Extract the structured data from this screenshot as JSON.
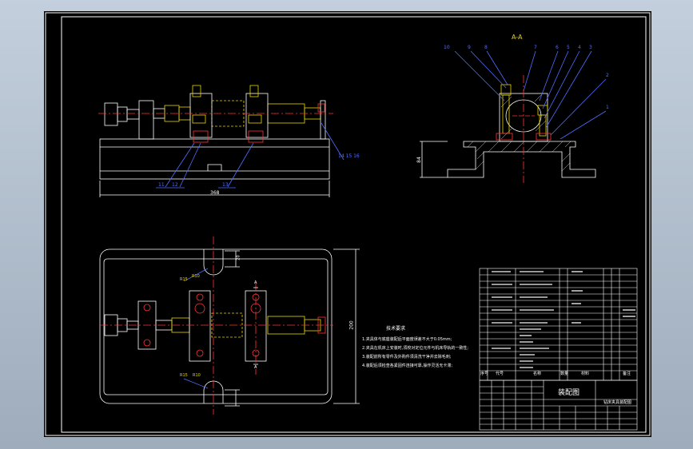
{
  "section_view": {
    "title": "A-A",
    "balloons": [
      "10",
      "9",
      "8",
      "7",
      "6",
      "5",
      "4",
      "3",
      "2",
      "1"
    ],
    "height_dim": "84"
  },
  "front_view": {
    "balloons": [
      "11",
      "12",
      "13",
      "14 15 16"
    ],
    "width_dim": "368"
  },
  "top_view": {
    "radius_labels": [
      "R10",
      "R15",
      "R15",
      "R10"
    ],
    "width_dim": "20",
    "height_dim": "200",
    "section_marks": [
      "A",
      "A"
    ]
  },
  "tech_requirements": {
    "heading": "技术要求",
    "lines": [
      "1.夹具体与底座装配后平面度误差不大于0.05mm;",
      "2.夹具在机床上安装时,须校对定位元件与机床导轨的一致性;",
      "3.装配前所有零件及外购件须清洗干净并去除毛刺;",
      "4.装配后须检查各紧固件连接可靠,操作灵活无卡滞;"
    ]
  },
  "title_block": {
    "title": "装配图",
    "drawing_name": "钻床夹具装配图",
    "header_row": [
      "序号",
      "代号",
      "名称",
      "数量",
      "材料",
      "备注"
    ]
  }
}
